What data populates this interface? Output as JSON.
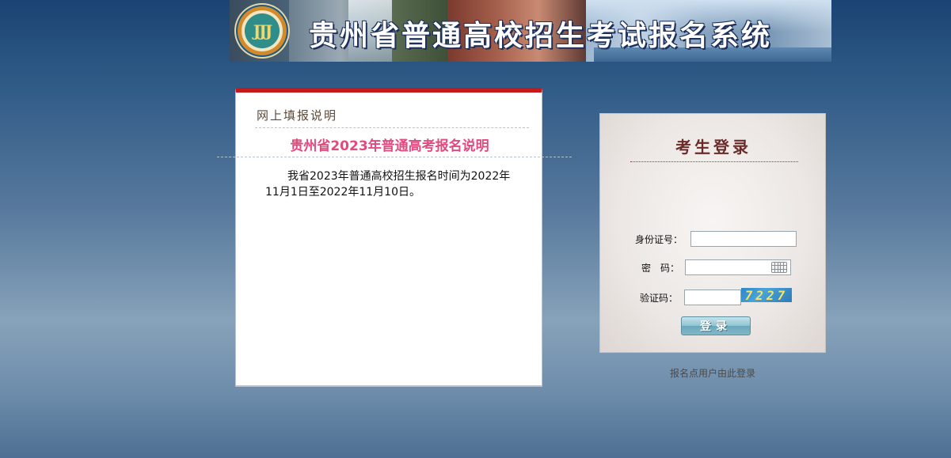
{
  "banner": {
    "title": "贵州省普通高校招生考试报名系统",
    "logo_icon": "provincial-emblem-icon",
    "logo_glyph": "JJJ"
  },
  "notice": {
    "heading": "网上填报说明",
    "title": "贵州省2023年普通高考报名说明",
    "body": "我省2023年普通高校招生报名时间为2022年11月1日至2022年11月10日。",
    "title_color": "#e04a7e",
    "accent_color": "#c61a1a"
  },
  "login": {
    "title": "考生登录",
    "id_label": "身份证号：",
    "id_value": "",
    "password_label": "密　码：",
    "password_value": "",
    "keyboard_icon": "keyboard-icon",
    "captcha_label": "验证码：",
    "captcha_value": "",
    "captcha_image_text": "7227",
    "button_label": "登录"
  },
  "site_login_link": "报名点用户由此登录"
}
